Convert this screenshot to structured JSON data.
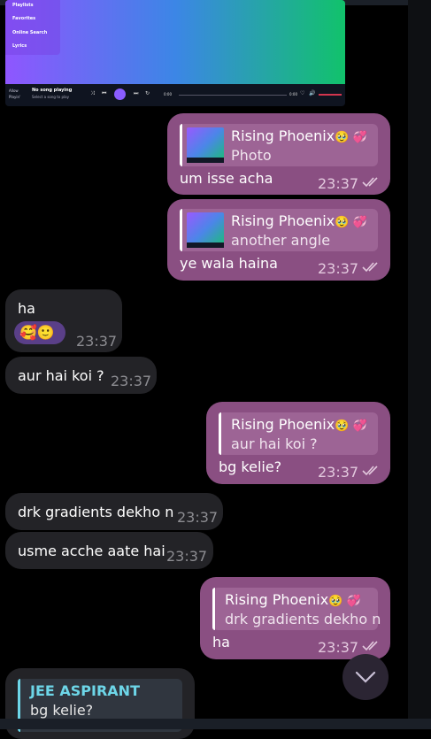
{
  "embedded_app": {
    "sidebar_items": [
      "Playlists",
      "Favorites",
      "Online Search",
      "Lyrics"
    ],
    "logo": [
      "Allow",
      "Playin'"
    ],
    "now_playing_title": "No song playing",
    "now_playing_sub": "Select a song to play",
    "time_start": "0:00",
    "time_end": "0:00"
  },
  "messages": [
    {
      "id": "m1",
      "reply_name": "Rising Phoenix",
      "reply_emoji": "🥹 💞",
      "reply_text": "Photo",
      "text": "um isse acha",
      "time": "23:37"
    },
    {
      "id": "m2",
      "reply_name": "Rising Phoenix",
      "reply_emoji": "🥹 💞",
      "reply_text": "another angle",
      "text": "ye wala haina",
      "time": "23:37"
    },
    {
      "id": "m3",
      "text": "ha",
      "stickers": "🥰🙂",
      "time": "23:37"
    },
    {
      "id": "m4",
      "text": "aur hai koi ?",
      "time": "23:37"
    },
    {
      "id": "m5",
      "reply_name": "Rising Phoenix",
      "reply_emoji": "🥹 💞",
      "reply_text": "aur hai koi ?",
      "text": "bg kelie?",
      "time": "23:37"
    },
    {
      "id": "m6",
      "text": "drk gradients dekho n",
      "time": "23:37"
    },
    {
      "id": "m7",
      "text": "usme acche aate hai",
      "time": "23:37"
    },
    {
      "id": "m8",
      "reply_name": "Rising Phoenix",
      "reply_emoji": "🥹 💞",
      "reply_text": "drk gradients dekho n",
      "text": "ha",
      "time": "23:37"
    },
    {
      "id": "m9",
      "reply_name": "JEE ASPIRANT",
      "reply_text": "bg kelie?"
    }
  ],
  "colors": {
    "outgoing_bubble": "#8a4f82",
    "incoming_bubble": "#232327",
    "reply_accent": "#6dd6e8"
  },
  "icons": {
    "read_receipt": "double-check-icon",
    "scroll_down": "chevron-down-icon"
  }
}
